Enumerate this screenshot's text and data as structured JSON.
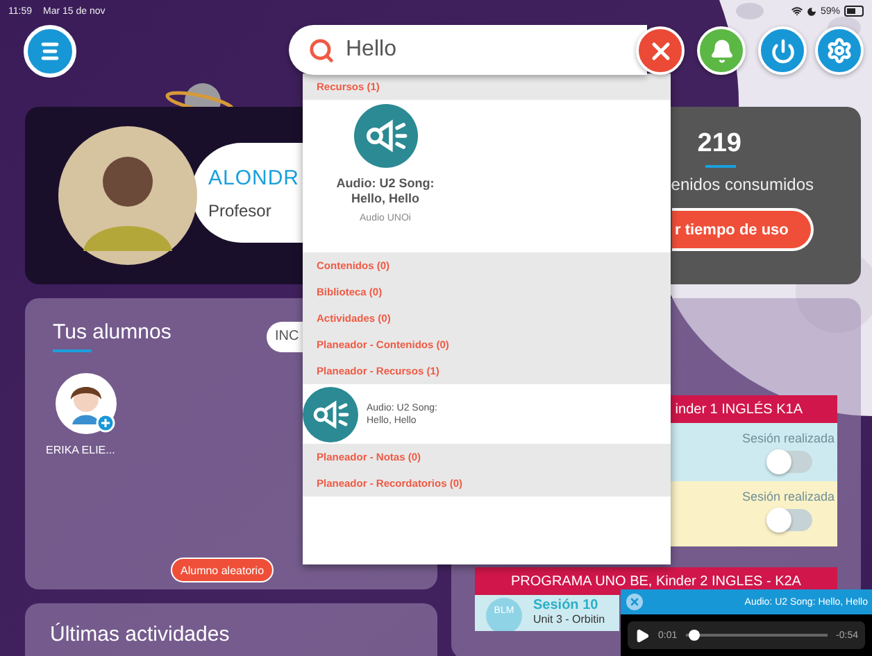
{
  "status_bar": {
    "time": "11:59",
    "date": "Mar 15 de nov",
    "battery": "59%"
  },
  "search": {
    "value": "Hello"
  },
  "profile": {
    "name": "ALONDR",
    "role": "Profesor"
  },
  "stats": {
    "count": "219",
    "label": "enidos consumidos",
    "button": "r tiempo de uso"
  },
  "students": {
    "title": "Tus alumnos",
    "filter": "INC",
    "items": [
      {
        "name": "ERIKA ELIE..."
      }
    ],
    "random_button": "Alumno aleatorio"
  },
  "classes": [
    {
      "title": "inder 1 INGLÉS K1A",
      "sessions": [
        {
          "kind": "toggle",
          "color": "#cdeaf0",
          "label": "Sesión realizada",
          "on": false
        },
        {
          "kind": "toggle",
          "color": "#faf2c6",
          "label": "Sesión realizada",
          "on": false
        }
      ]
    },
    {
      "title": "PROGRAMA UNO BE, Kinder 2 INGLES - K2A",
      "sessions": [
        {
          "kind": "lesson",
          "color": "#cdeaf0",
          "logo": "BLM",
          "session": "Sesión 10",
          "unit": "Unit 3 - Orbitin"
        }
      ]
    }
  ],
  "activities": {
    "title": "Últimas actividades"
  },
  "results": [
    {
      "kind": "header",
      "label": "Recursos (1)"
    },
    {
      "kind": "card",
      "title": "Audio: U2 Song: Hello, Hello",
      "subtitle": "Audio UNOi"
    },
    {
      "kind": "header",
      "label": "Contenidos (0)"
    },
    {
      "kind": "header",
      "label": "Biblioteca (0)"
    },
    {
      "kind": "header",
      "label": "Actividades (0)"
    },
    {
      "kind": "header",
      "label": "Planeador - Contenidos (0)"
    },
    {
      "kind": "header",
      "label": "Planeador - Recursos (1)"
    },
    {
      "kind": "row",
      "title": "Audio: U2 Song: Hello, Hello"
    },
    {
      "kind": "header",
      "label": "Planeador - Notas (0)"
    },
    {
      "kind": "header",
      "label": "Planeador - Recordatorios (0)"
    }
  ],
  "player": {
    "title": "Audio: U2 Song: Hello, Hello",
    "elapsed": "0:01",
    "remaining": "-0:54",
    "level": 0.03
  }
}
